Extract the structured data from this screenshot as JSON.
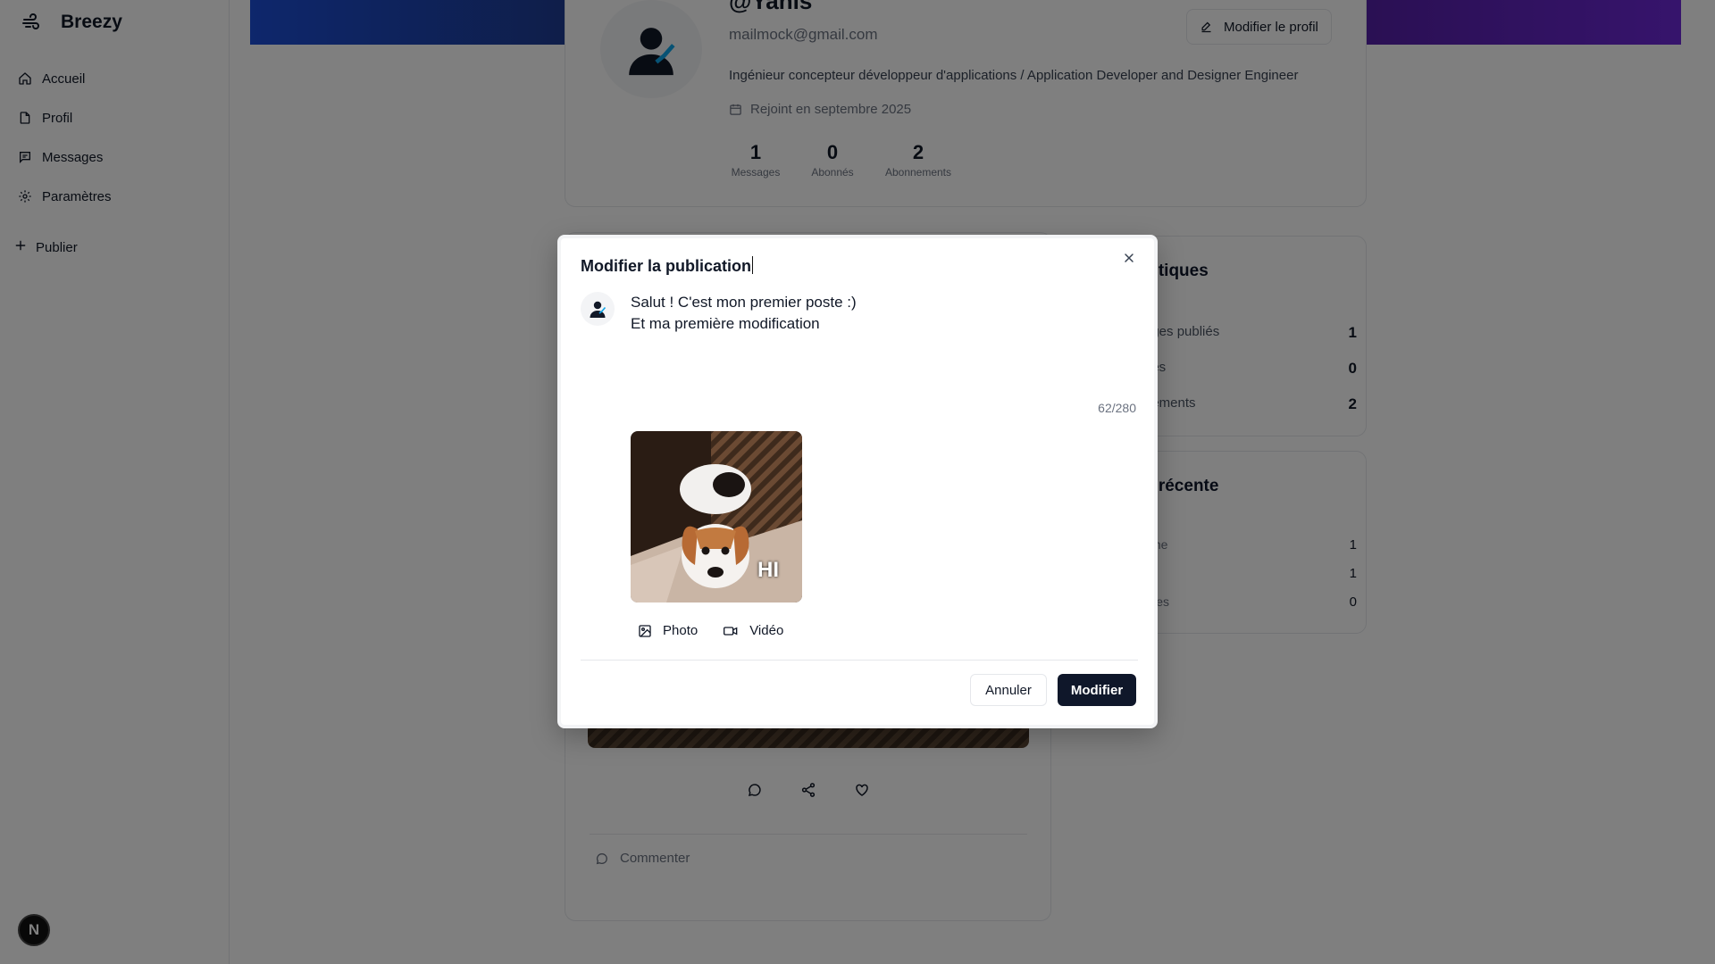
{
  "sidebar": {
    "brand": "Breezy",
    "items": [
      {
        "label": "Accueil",
        "icon": "home-icon"
      },
      {
        "label": "Profil",
        "icon": "file-icon"
      },
      {
        "label": "Messages",
        "icon": "message-icon"
      },
      {
        "label": "Paramètres",
        "icon": "gear-icon"
      }
    ],
    "publish_label": "Publier",
    "badge": "N"
  },
  "profile": {
    "handle": "@Yanis",
    "email": "mailmock@gmail.com",
    "bio": "Ingénieur concepteur développeur d'applications / Application Developer and Designer Engineer",
    "joined": "Rejoint en septembre 2025",
    "edit_button": "Modifier le profil",
    "stats": [
      {
        "value": "1",
        "label": "Messages"
      },
      {
        "value": "0",
        "label": "Abonnés"
      },
      {
        "value": "2",
        "label": "Abonnements"
      }
    ]
  },
  "stats_panel": {
    "title": "istiques",
    "rows": [
      {
        "label": "ages publiés",
        "value": "1"
      },
      {
        "label": "nés",
        "value": "0"
      },
      {
        "label": "nements",
        "value": "2"
      }
    ]
  },
  "activity_panel": {
    "title": "é récente",
    "rows": [
      {
        "label": "aine",
        "value": "1"
      },
      {
        "label": "",
        "value": "1"
      },
      {
        "label": "likes",
        "value": "0"
      }
    ]
  },
  "post": {
    "comment_placeholder": "Commenter"
  },
  "modal": {
    "title": "Modifier la publication",
    "text": "Salut ! C'est mon premier poste :)\nEt ma première modification",
    "counter": "62/280",
    "media_caption": "HI",
    "photo_label": "Photo",
    "video_label": "Vidéo",
    "cancel_label": "Annuler",
    "submit_label": "Modifier"
  }
}
